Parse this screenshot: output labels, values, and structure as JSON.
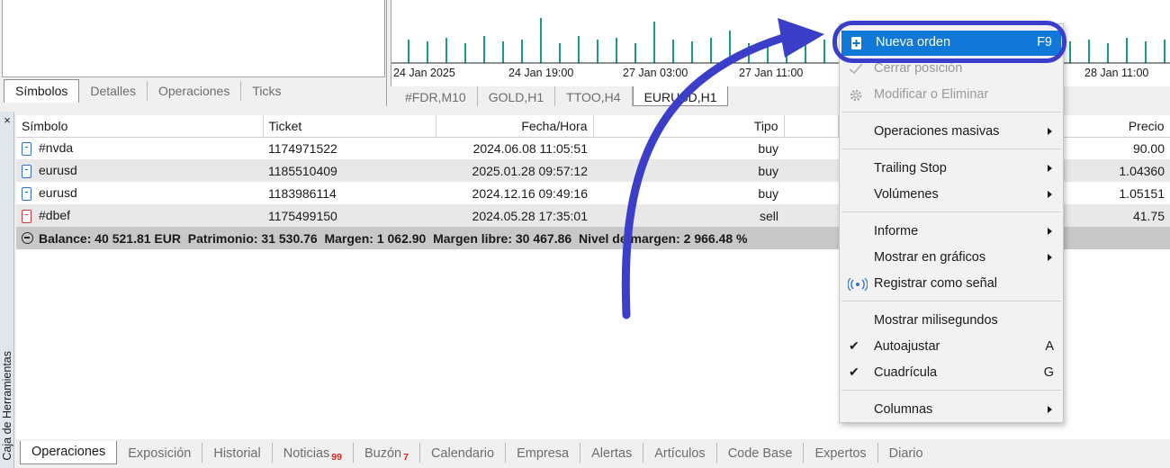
{
  "symbols_tabs": [
    "Símbolos",
    "Detalles",
    "Operaciones",
    "Ticks"
  ],
  "chart": {
    "time_labels": [
      "24 Jan 2025",
      "24 Jan 19:00",
      "27 Jan 03:00",
      "27 Jan 11:00",
      "28 Jan 11:00"
    ],
    "bar_color": "#1a9a86"
  },
  "chart_tabs": [
    "#FDR,M10",
    "GOLD,H1",
    "TTOO,H4",
    "EURUSD,H1"
  ],
  "toolbox": {
    "close": "×",
    "label": "Caja de Herramientas"
  },
  "table": {
    "headers": [
      "Símbolo",
      "Ticket",
      "Fecha/Hora",
      "Tipo",
      "Precio"
    ],
    "rows": [
      {
        "symbol": "#nvda",
        "ticket": "1174971522",
        "datetime": "2024.06.08 11:05:51",
        "type": "buy",
        "price": "90.00"
      },
      {
        "symbol": "eurusd",
        "ticket": "1185510409",
        "datetime": "2025.01.28 09:57:12",
        "type": "buy",
        "price": "1.04360"
      },
      {
        "symbol": "eurusd",
        "ticket": "1183986114",
        "datetime": "2024.12.16 09:49:16",
        "type": "buy",
        "price": "1.05151"
      },
      {
        "symbol": "#dbef",
        "ticket": "1175499150",
        "datetime": "2024.05.28 17:35:01",
        "type": "sell",
        "price": "41.75"
      }
    ],
    "summary": "Balance: 40 521.81 EUR  Patrimonio: 31 530.76  Margen: 1 062.90  Margen libre: 30 467.86  Nivel de margen: 2 966.48 %"
  },
  "bottom_tabs": [
    {
      "label": "Operaciones",
      "badge": ""
    },
    {
      "label": "Exposición",
      "badge": ""
    },
    {
      "label": "Historial",
      "badge": ""
    },
    {
      "label": "Noticias",
      "badge": "99"
    },
    {
      "label": "Buzón",
      "badge": "7"
    },
    {
      "label": "Calendario",
      "badge": ""
    },
    {
      "label": "Empresa",
      "badge": ""
    },
    {
      "label": "Alertas",
      "badge": ""
    },
    {
      "label": "Artículos",
      "badge": ""
    },
    {
      "label": "Code Base",
      "badge": ""
    },
    {
      "label": "Expertos",
      "badge": ""
    },
    {
      "label": "Diario",
      "badge": ""
    }
  ],
  "context_menu": {
    "nueva_orden": {
      "label": "Nueva orden",
      "shortcut": "F9"
    },
    "cerrar_posicion": "Cerrar posición",
    "modificar": "Modificar o Eliminar",
    "operaciones_masivas": "Operaciones masivas",
    "trailing_stop": "Trailing Stop",
    "volumenes": "Volúmenes",
    "informe": "Informe",
    "mostrar_graficos": "Mostrar en gráficos",
    "registrar_senal": "Registrar como señal",
    "mostrar_ms": "Mostrar milisegundos",
    "autoajustar": {
      "label": "Autoajustar",
      "shortcut": "A"
    },
    "cuadricula": {
      "label": "Cuadrícula",
      "shortcut": "G"
    },
    "columnas": "Columnas",
    "check_mark": "✔"
  },
  "colors": {
    "highlight": "#0f78d8",
    "annotation": "#3a3ec8"
  }
}
